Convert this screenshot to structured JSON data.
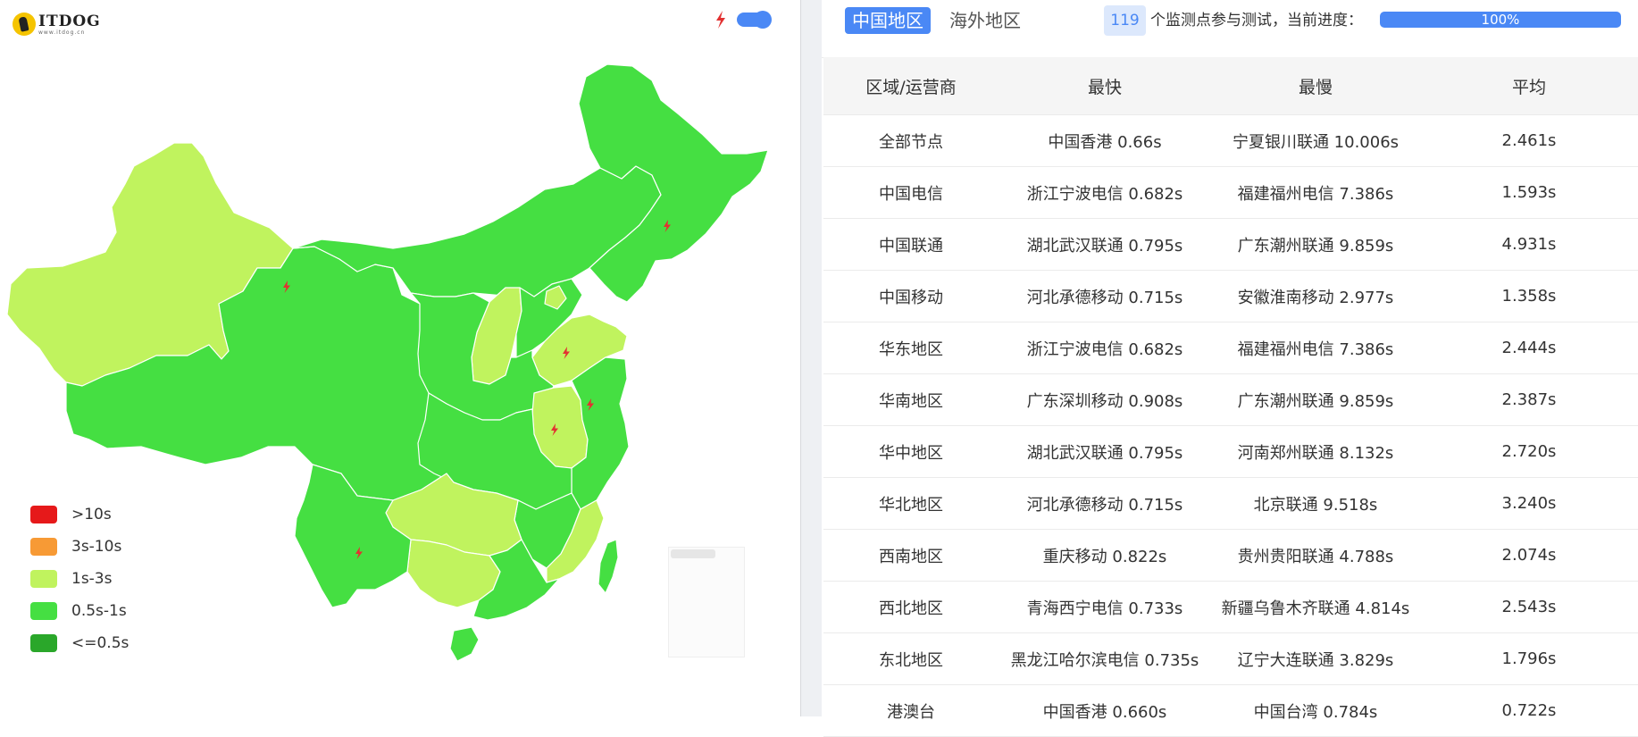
{
  "logo": {
    "name": "ITDOG",
    "url": "www.itdog.cn"
  },
  "toggle": {
    "enabled": true
  },
  "legend": [
    {
      "label": ">10s",
      "color": "#e6191a"
    },
    {
      "label": "3s-10s",
      "color": "#f79a35"
    },
    {
      "label": "1s-3s",
      "color": "#c0f35e"
    },
    {
      "label": "0.5s-1s",
      "color": "#45df42"
    },
    {
      "label": "<=0.5s",
      "color": "#2aa72a"
    }
  ],
  "colors": {
    "accent": "#4a88f5",
    "map_fast": "#45df42",
    "map_slow": "#c0f35e",
    "flash": "#e23131"
  },
  "tabs": {
    "china": "中国地区",
    "overseas": "海外地区"
  },
  "monitor": {
    "count": "119",
    "text": "个监测点参与测试，当前进度：",
    "progress": "100%",
    "progress_value": 1.0
  },
  "table": {
    "headers": [
      "区域/运营商",
      "最快",
      "最慢",
      "平均"
    ],
    "rows": [
      [
        "全部节点",
        "中国香港 0.66s",
        "宁夏银川联通 10.006s",
        "2.461s"
      ],
      [
        "中国电信",
        "浙江宁波电信 0.682s",
        "福建福州电信 7.386s",
        "1.593s"
      ],
      [
        "中国联通",
        "湖北武汉联通 0.795s",
        "广东潮州联通 9.859s",
        "4.931s"
      ],
      [
        "中国移动",
        "河北承德移动 0.715s",
        "安徽淮南移动 2.977s",
        "1.358s"
      ],
      [
        "华东地区",
        "浙江宁波电信 0.682s",
        "福建福州电信 7.386s",
        "2.444s"
      ],
      [
        "华南地区",
        "广东深圳移动 0.908s",
        "广东潮州联通 9.859s",
        "2.387s"
      ],
      [
        "华中地区",
        "湖北武汉联通 0.795s",
        "河南郑州联通 8.132s",
        "2.720s"
      ],
      [
        "华北地区",
        "河北承德移动 0.715s",
        "北京联通 9.518s",
        "3.240s"
      ],
      [
        "西南地区",
        "重庆移动 0.822s",
        "贵州贵阳联通 4.788s",
        "2.074s"
      ],
      [
        "西北地区",
        "青海西宁电信 0.733s",
        "新疆乌鲁木齐联通 4.814s",
        "2.543s"
      ],
      [
        "东北地区",
        "黑龙江哈尔滨电信 0.735s",
        "辽宁大连联通 3.829s",
        "1.796s"
      ],
      [
        "港澳台",
        "中国香港 0.660s",
        "中国台湾 0.784s",
        "0.722s"
      ]
    ]
  }
}
